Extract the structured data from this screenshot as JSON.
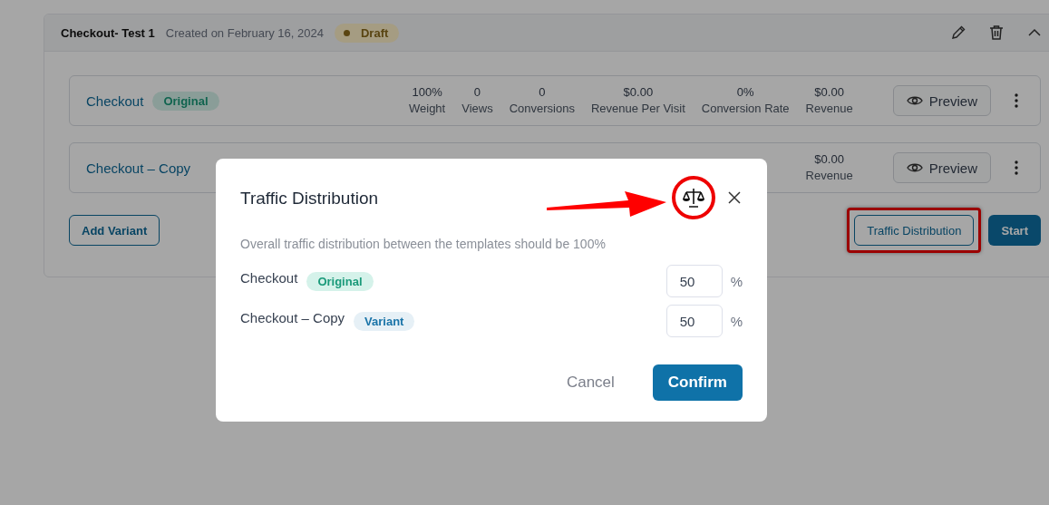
{
  "test": {
    "title": "Checkout- Test 1",
    "created": "Created on February 16, 2024",
    "status": "Draft",
    "expanded": true
  },
  "variants": [
    {
      "name": "Checkout",
      "badge": "Original",
      "kind": "original",
      "stats": [
        {
          "value": "100%",
          "label": "Weight"
        },
        {
          "value": "0",
          "label": "Views"
        },
        {
          "value": "0",
          "label": "Conversions"
        },
        {
          "value": "$0.00",
          "label": "Revenue Per Visit"
        },
        {
          "value": "0%",
          "label": "Conversion Rate"
        },
        {
          "value": "$0.00",
          "label": "Revenue"
        }
      ],
      "preview": "Preview"
    },
    {
      "name": "Checkout – Copy",
      "stats": [
        {
          "value": "$0.00",
          "label": "Revenue"
        }
      ],
      "preview": "Preview"
    }
  ],
  "actions": {
    "add": "Add Variant",
    "traffic": "Traffic Distribution",
    "start": "Start"
  },
  "modal": {
    "title": "Traffic Distribution",
    "hint": "Overall traffic distribution between the templates should be 100%",
    "rows": [
      {
        "name": "Checkout",
        "badge": "Original",
        "kind": "original",
        "value": "50",
        "unit": "%"
      },
      {
        "name": "Checkout – Copy",
        "badge": "Variant",
        "kind": "variant",
        "value": "50",
        "unit": "%"
      }
    ],
    "cancel": "Cancel",
    "confirm": "Confirm"
  }
}
